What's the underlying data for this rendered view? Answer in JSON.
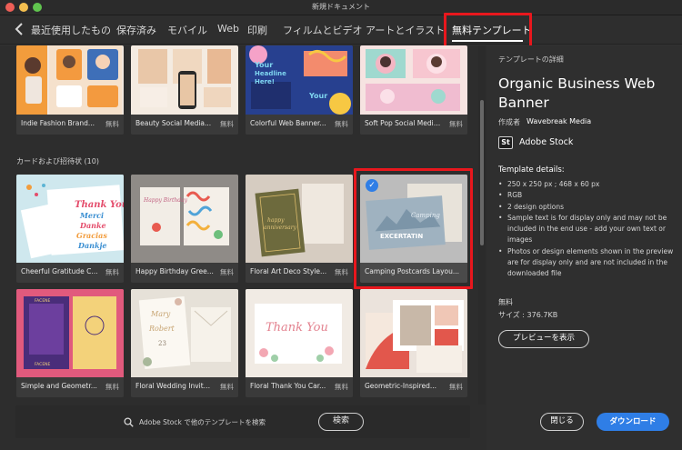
{
  "window": {
    "title": "新規ドキュメント"
  },
  "tabs": [
    {
      "label": "最近使用したもの"
    },
    {
      "label": "保存済み"
    },
    {
      "label": "モバイル"
    },
    {
      "label": "Web"
    },
    {
      "label": "印刷"
    },
    {
      "label": "フィルムとビデオ"
    },
    {
      "label": "アートとイラスト"
    },
    {
      "label": "無料テンプレート"
    }
  ],
  "top_row": [
    {
      "name": "Indie Fashion Brand...",
      "price": "無料"
    },
    {
      "name": "Beauty Social Media...",
      "price": "無料"
    },
    {
      "name": "Colorful Web Banner...",
      "price": "無料"
    },
    {
      "name": "Soft Pop Social Media...",
      "price": "無料"
    }
  ],
  "section": {
    "label": "カードおよび招待状 (10)"
  },
  "cards_row1": [
    {
      "name": "Cheerful Gratitude C...",
      "price": "無料"
    },
    {
      "name": "Happy Birthday Gree...",
      "price": "無料"
    },
    {
      "name": "Floral Art Deco Style...",
      "price": "無料"
    },
    {
      "name": "Camping Postcards Layou...",
      "price": ""
    }
  ],
  "cards_row2": [
    {
      "name": "Simple and Geometr...",
      "price": "無料"
    },
    {
      "name": "Floral Wedding Invita...",
      "price": "無料"
    },
    {
      "name": "Floral Thank You Car...",
      "price": "無料"
    },
    {
      "name": "Geometric-Inspired...",
      "price": "無料"
    }
  ],
  "thumb_text": {
    "thanks": [
      "Thank You",
      "Merci",
      "Danke",
      "Gracias",
      "Dankje"
    ],
    "birthday": "Happy Birthday",
    "anniversary": [
      "happy",
      "anniversary"
    ],
    "camping": [
      "Camping",
      "EXCERTATIN"
    ],
    "wedding": [
      "Mary",
      "Robert",
      "23"
    ],
    "thank_you": "Thank You",
    "web_banner": [
      "Your",
      "Headline",
      "Here!"
    ],
    "geo": [
      "FACENE",
      "FACENE"
    ]
  },
  "search": {
    "placeholder": "Adobe Stock で他のテンプレートを検索",
    "button": "検索"
  },
  "details": {
    "caption": "テンプレートの詳細",
    "title": "Organic Business Web Banner",
    "author_label": "作成者",
    "author": "Wavebreak Media",
    "stock_logo": "St",
    "stock_label": "Adobe Stock",
    "heading": "Template details:",
    "items": [
      "250 x 250 px ; 468 x 60 px",
      "RGB",
      "2 design options",
      "Sample text is for display only and may not be included in the end use - add your own text or images",
      "Photos or design elements shown in the preview are for display only and are not included in the downloaded file"
    ],
    "price": "無料",
    "size": "サイズ : 376.7KB",
    "preview_button": "プレビューを表示"
  },
  "footer": {
    "close": "閉じる",
    "download": "ダウンロード"
  },
  "colors": {
    "accent": "#2f7ee6",
    "highlight": "#e8171d"
  }
}
